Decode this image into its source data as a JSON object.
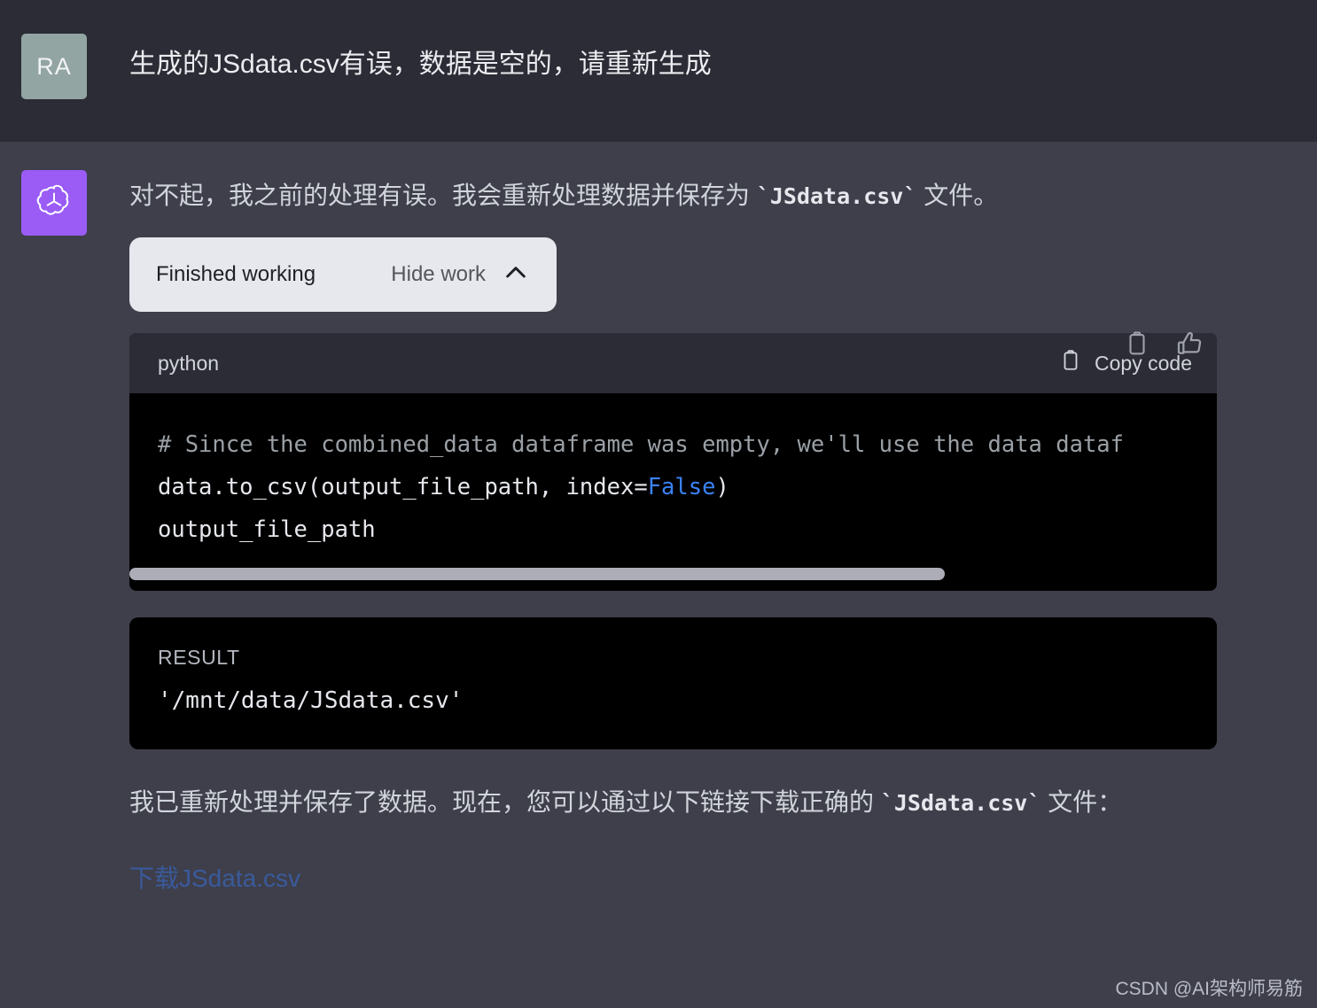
{
  "user": {
    "avatar_initials": "RA",
    "message": "生成的JSdata.csv有误，数据是空的，请重新生成"
  },
  "assistant": {
    "avatar_icon": "openai-logo-icon",
    "lead_prefix": "对不起，我之前的处理有误。我会重新处理数据并保存为 ",
    "lead_code": "`JSdata.csv`",
    "lead_suffix": " 文件。",
    "actions": {
      "copy_label": "copy-icon",
      "thumbs_up_label": "thumbs-up-icon"
    },
    "work": {
      "status_label": "Finished working",
      "toggle_label": "Hide work",
      "toggle_icon": "chevron-up-icon"
    },
    "code_block": {
      "language": "python",
      "copy_label": "Copy code",
      "copy_icon": "clipboard-icon",
      "lines": [
        "# Since the combined_data dataframe was empty, we'll use the data dataf",
        "data.to_csv(output_file_path, index=False)",
        "output_file_path"
      ],
      "keyword_token": "False",
      "scroll_thumb_percent": 75
    },
    "result_block": {
      "label": "RESULT",
      "value": "'/mnt/data/JSdata.csv'"
    },
    "closing_prefix": "我已重新处理并保存了数据。现在，您可以通过以下链接下载正确的 ",
    "closing_code": "`JSdata.csv`",
    "closing_suffix": " 文件：",
    "download_link": "下载JSdata.csv"
  },
  "watermark": "CSDN @AI架构师易筋",
  "colors": {
    "user_bg": "#2b2c35",
    "assistant_bg": "#3e3f4b",
    "avatar_user": "#93a5a3",
    "avatar_assistant": "#9a5cf5",
    "pill_bg": "#e7e7ee",
    "code_bg": "#000000",
    "link": "#3a5a9c",
    "keyword": "#3b82f6"
  }
}
